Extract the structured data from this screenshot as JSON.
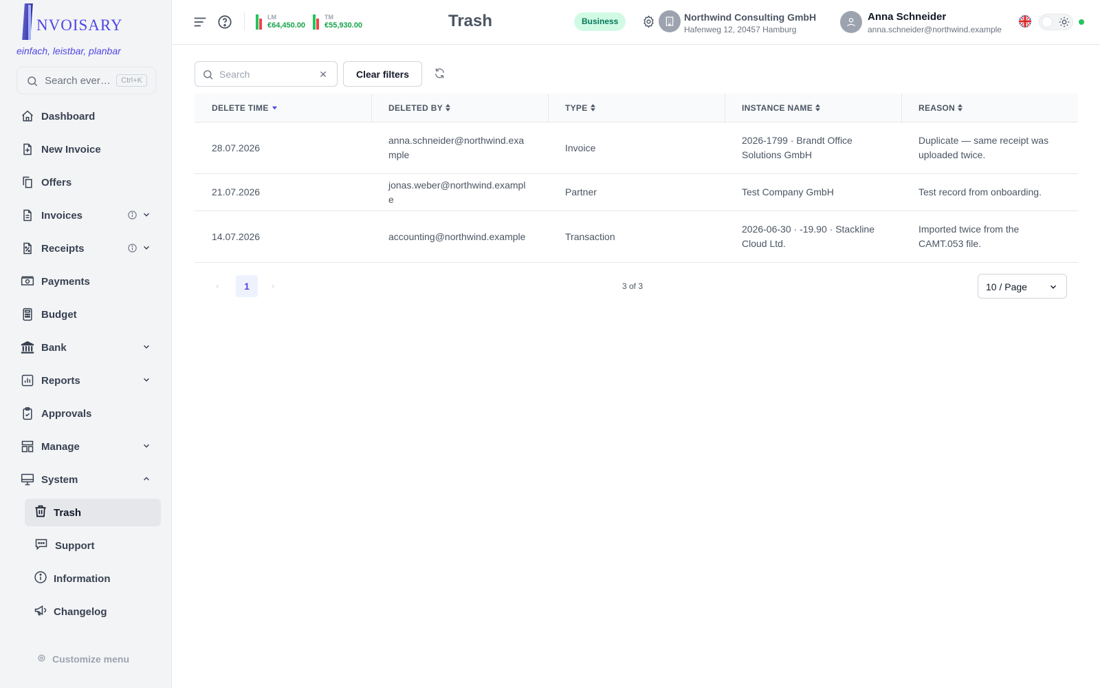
{
  "sidebar": {
    "brand": "NVOISARY",
    "tagline": "einfach, leistbar, planbar",
    "search_placeholder": "Search ever…",
    "search_shortcut": "Ctrl+K",
    "items": {
      "dashboard": "Dashboard",
      "new_invoice": "New Invoice",
      "offers": "Offers",
      "invoices": "Invoices",
      "receipts": "Receipts",
      "payments": "Payments",
      "budget": "Budget",
      "bank": "Bank",
      "reports": "Reports",
      "approvals": "Approvals",
      "manage": "Manage",
      "system": "System"
    },
    "system_sub": {
      "trash": "Trash",
      "support": "Support",
      "information": "Information",
      "changelog": "Changelog"
    },
    "customize": "Customize menu"
  },
  "header": {
    "kpi_lm": {
      "label": "LM",
      "value": "€64,450.00"
    },
    "kpi_tm": {
      "label": "TM",
      "value": "€55,930.00"
    },
    "title": "Trash",
    "plan_badge": "Business",
    "company_name": "Northwind Consulting GmbH",
    "company_address": "Hafenweg 12, 20457 Hamburg",
    "user_name": "Anna Schneider",
    "user_email": "anna.schneider@northwind.example"
  },
  "toolbar": {
    "search_placeholder": "Search",
    "search_value": "",
    "clear_filters": "Clear filters"
  },
  "table": {
    "columns": {
      "delete_time": "DELETE TIME",
      "deleted_by": "DELETED BY",
      "type": "TYPE",
      "instance_name": "INSTANCE NAME",
      "reason": "REASON"
    },
    "rows": [
      {
        "delete_time": "28.07.2026",
        "deleted_by": "anna.schneider@northwind.example",
        "type": "Invoice",
        "instance_name": "2026-1799 · Brandt Office Solutions GmbH",
        "reason": "Duplicate — same receipt was uploaded twice."
      },
      {
        "delete_time": "21.07.2026",
        "deleted_by": "jonas.weber@northwind.example",
        "type": "Partner",
        "instance_name": "Test Company GmbH",
        "reason": "Test record from onboarding."
      },
      {
        "delete_time": "14.07.2026",
        "deleted_by": "accounting@northwind.example",
        "type": "Transaction",
        "instance_name": "2026-06-30 · -19.90 · Stackline Cloud Ltd.",
        "reason": "Imported twice from the CAMT.053 file."
      }
    ]
  },
  "pagination": {
    "prev": "‹",
    "current_page": "1",
    "next": "›",
    "count": "3 of 3",
    "page_size": "10 / Page"
  },
  "colors": {
    "accent": "#4f46e5",
    "positive": "#16a34a",
    "badge_bg": "#d1fae5",
    "sidebar_bg": "#f3f4f6"
  },
  "icons": {
    "menu": "menu-icon",
    "help": "help-icon",
    "settings": "gear-icon",
    "company": "building-icon",
    "user": "user-icon",
    "language": "uk-flag-icon",
    "theme": "sun-icon",
    "refresh": "refresh-icon"
  }
}
